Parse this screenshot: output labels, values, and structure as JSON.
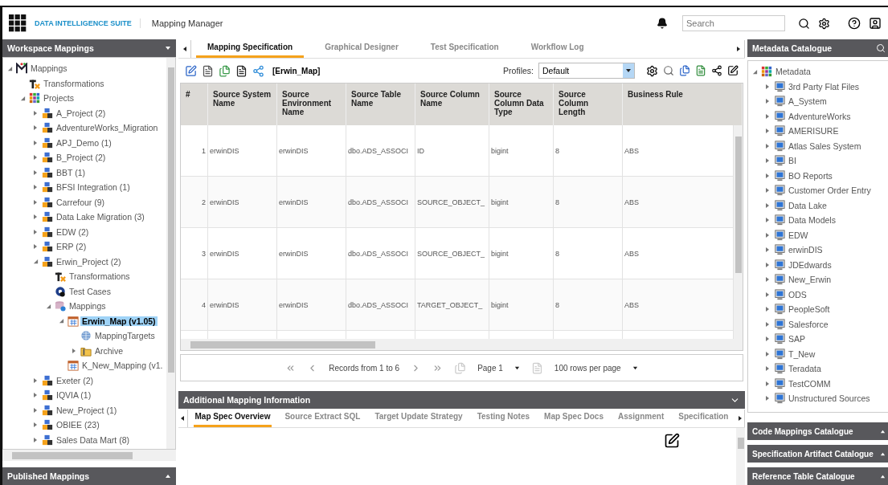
{
  "header": {
    "app_name": "DATA INTELLIGENCE SUITE",
    "module": "Mapping Manager",
    "search": {
      "placeholder": "Search"
    }
  },
  "left_panel": {
    "title": "Workspace Mappings",
    "tree": [
      {
        "label": "Mappings",
        "kind": "root",
        "expanded": true,
        "selected": false,
        "children": [
          {
            "label": "Transformations",
            "kind": "transform",
            "selected": false
          },
          {
            "label": "Projects",
            "kind": "projects",
            "expanded": true,
            "selected": false,
            "children": [
              {
                "label": "A_Project (2)",
                "kind": "project",
                "expanded": false,
                "selected": false
              },
              {
                "label": "AdventureWorks_Migration",
                "kind": "project",
                "expanded": false,
                "selected": false
              },
              {
                "label": "APJ_Demo (1)",
                "kind": "project",
                "expanded": false,
                "selected": false
              },
              {
                "label": "B_Project (2)",
                "kind": "project",
                "expanded": false,
                "selected": false
              },
              {
                "label": "BBT (1)",
                "kind": "project",
                "expanded": false,
                "selected": false
              },
              {
                "label": "BFSI Integration (1)",
                "kind": "project",
                "expanded": false,
                "selected": false
              },
              {
                "label": "Carrefour (9)",
                "kind": "project",
                "expanded": false,
                "selected": false
              },
              {
                "label": "Data Lake Migration (3)",
                "kind": "project",
                "expanded": false,
                "selected": false
              },
              {
                "label": "EDW (2)",
                "kind": "project",
                "expanded": false,
                "selected": false
              },
              {
                "label": "ERP (2)",
                "kind": "project",
                "expanded": false,
                "selected": false
              },
              {
                "label": "Erwin_Project (2)",
                "kind": "project",
                "expanded": true,
                "selected": false,
                "children": [
                  {
                    "label": "Transformations",
                    "kind": "transform",
                    "selected": false
                  },
                  {
                    "label": "Test Cases",
                    "kind": "testcases",
                    "selected": false
                  },
                  {
                    "label": "Mappings",
                    "kind": "mappings",
                    "expanded": true,
                    "selected": false,
                    "children": [
                      {
                        "label": "Erwin_Map (v1.05)",
                        "kind": "map",
                        "expanded": true,
                        "selected": true,
                        "children": [
                          {
                            "label": "MappingTargets",
                            "kind": "target",
                            "selected": false
                          },
                          {
                            "label": "Archive",
                            "kind": "archive",
                            "expanded": false,
                            "selected": false
                          }
                        ]
                      },
                      {
                        "label": "K_New_Mapping (v1.",
                        "kind": "map",
                        "selected": false
                      }
                    ]
                  }
                ]
              },
              {
                "label": "Exeter (2)",
                "kind": "project",
                "expanded": false,
                "selected": false
              },
              {
                "label": "IQVIA (1)",
                "kind": "project",
                "expanded": false,
                "selected": false
              },
              {
                "label": "New_Project (1)",
                "kind": "project",
                "expanded": false,
                "selected": false
              },
              {
                "label": "OBIEE (23)",
                "kind": "project",
                "expanded": false,
                "selected": false
              },
              {
                "label": "Sales Data Mart (8)",
                "kind": "project",
                "expanded": false,
                "selected": false
              }
            ]
          }
        ]
      }
    ]
  },
  "published_panel": {
    "title": "Published Mappings"
  },
  "main": {
    "tabs": [
      {
        "label": "Mapping Specification",
        "selected": true
      },
      {
        "label": "Graphical Designer",
        "selected": false
      },
      {
        "label": "Test Specification",
        "selected": false
      },
      {
        "label": "Workflow Log",
        "selected": false
      }
    ],
    "toolbar": {
      "map_name": "[Erwin_Map]",
      "profiles_label": "Profiles:",
      "profile": "Default"
    },
    "table": {
      "columns": [
        "#",
        "Source System Name",
        "Source Environment Name",
        "Source Table Name",
        "Source Column Name",
        "Source Column Data Type",
        "Source Column Length",
        "Business Rule"
      ],
      "rows": [
        [
          "1",
          "erwinDIS",
          "erwinDIS",
          "dbo.ADS_ASSOCI",
          "ID",
          "bigint",
          "8",
          "ABS"
        ],
        [
          "2",
          "erwinDIS",
          "erwinDIS",
          "dbo.ADS_ASSOCI",
          "SOURCE_OBJECT_",
          "bigint",
          "8",
          "ABS"
        ],
        [
          "3",
          "erwinDIS",
          "erwinDIS",
          "dbo.ADS_ASSOCI",
          "SOURCE_OBJECT_",
          "bigint",
          "8",
          "ABS"
        ],
        [
          "4",
          "erwinDIS",
          "erwinDIS",
          "dbo.ADS_ASSOCI",
          "TARGET_OBJECT_",
          "bigint",
          "8",
          "ABS"
        ]
      ]
    },
    "pagination": {
      "records": "Records from 1 to 6",
      "page": "Page 1",
      "rows_per_page": "100 rows per page"
    }
  },
  "additional": {
    "title": "Additional Mapping Information",
    "tabs": [
      {
        "label": "Map Spec Overview",
        "selected": true
      },
      {
        "label": "Source Extract SQL",
        "selected": false
      },
      {
        "label": "Target Update Strategy",
        "selected": false
      },
      {
        "label": "Testing Notes",
        "selected": false
      },
      {
        "label": "Map Spec Docs",
        "selected": false
      },
      {
        "label": "Assignment",
        "selected": false
      },
      {
        "label": "Specification",
        "selected": false
      }
    ]
  },
  "right_panel": {
    "title": "Metadata Catalogue",
    "tree": [
      {
        "label": "Metadata",
        "kind": "metadata",
        "expanded": true,
        "selected": false,
        "children": [
          {
            "label": "3rd Party Flat Files",
            "kind": "system",
            "expanded": false,
            "selected": false
          },
          {
            "label": "A_System",
            "kind": "system",
            "expanded": false,
            "selected": false
          },
          {
            "label": "AdventureWorks",
            "kind": "system",
            "expanded": false,
            "selected": false
          },
          {
            "label": "AMERISURE",
            "kind": "system",
            "expanded": false,
            "selected": false
          },
          {
            "label": "Atlas Sales System",
            "kind": "system",
            "expanded": false,
            "selected": false
          },
          {
            "label": "BI",
            "kind": "system",
            "expanded": false,
            "selected": false
          },
          {
            "label": "BO Reports",
            "kind": "system",
            "expanded": false,
            "selected": false
          },
          {
            "label": "Customer Order Entry",
            "kind": "system",
            "expanded": false,
            "selected": false
          },
          {
            "label": "Data Lake",
            "kind": "system",
            "expanded": false,
            "selected": false
          },
          {
            "label": "Data Models",
            "kind": "system",
            "expanded": false,
            "selected": false
          },
          {
            "label": "EDW",
            "kind": "system",
            "expanded": false,
            "selected": false
          },
          {
            "label": "erwinDIS",
            "kind": "system",
            "expanded": false,
            "selected": false
          },
          {
            "label": "JDEdwards",
            "kind": "system",
            "expanded": false,
            "selected": false
          },
          {
            "label": "New_Erwin",
            "kind": "system",
            "expanded": false,
            "selected": false
          },
          {
            "label": "ODS",
            "kind": "system",
            "expanded": false,
            "selected": false
          },
          {
            "label": "PeopleSoft",
            "kind": "system",
            "expanded": false,
            "selected": false
          },
          {
            "label": "Salesforce",
            "kind": "system",
            "expanded": false,
            "selected": false
          },
          {
            "label": "SAP",
            "kind": "system",
            "expanded": false,
            "selected": false
          },
          {
            "label": "T_New",
            "kind": "system",
            "expanded": false,
            "selected": false
          },
          {
            "label": "Teradata",
            "kind": "system",
            "expanded": false,
            "selected": false
          },
          {
            "label": "TestCOMM",
            "kind": "system",
            "expanded": false,
            "selected": false
          },
          {
            "label": "Unstructured Sources",
            "kind": "system",
            "expanded": false,
            "selected": false
          }
        ]
      }
    ]
  },
  "collapsed_panels": [
    "Code Mappings Catalogue",
    "Specification Artifact Catalogue",
    "Reference Table Catalogue"
  ]
}
